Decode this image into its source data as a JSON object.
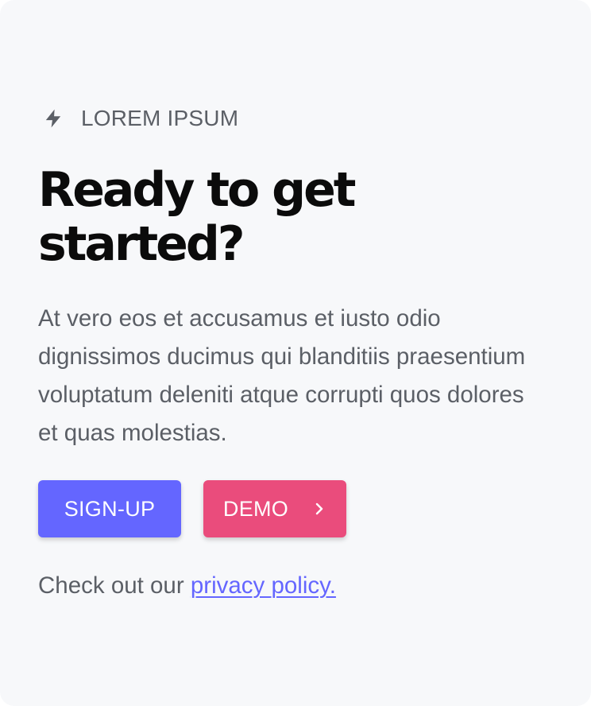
{
  "eyebrow": {
    "icon": "lightning-bolt-icon",
    "text": "LOREM IPSUM"
  },
  "title": {
    "line1": "Ready to get",
    "line2": "started?"
  },
  "description": "At vero eos et accusamus et iusto odio dignissimos ducimus qui blanditiis praesentium voluptatum deleniti atque corrupti quos dolores et quas molestias.",
  "buttons": {
    "primary_label": "SIGN-UP",
    "secondary_label": "DEMO",
    "secondary_icon": "chevron-right-icon"
  },
  "footer": {
    "text": "Check out our",
    "link_text": "privacy policy."
  },
  "colors": {
    "background": "#f7f8fa",
    "primary": "#6466ff",
    "secondary": "#ea4c7c",
    "heading": "#0b0b0b",
    "body_text": "#5b5f66"
  }
}
